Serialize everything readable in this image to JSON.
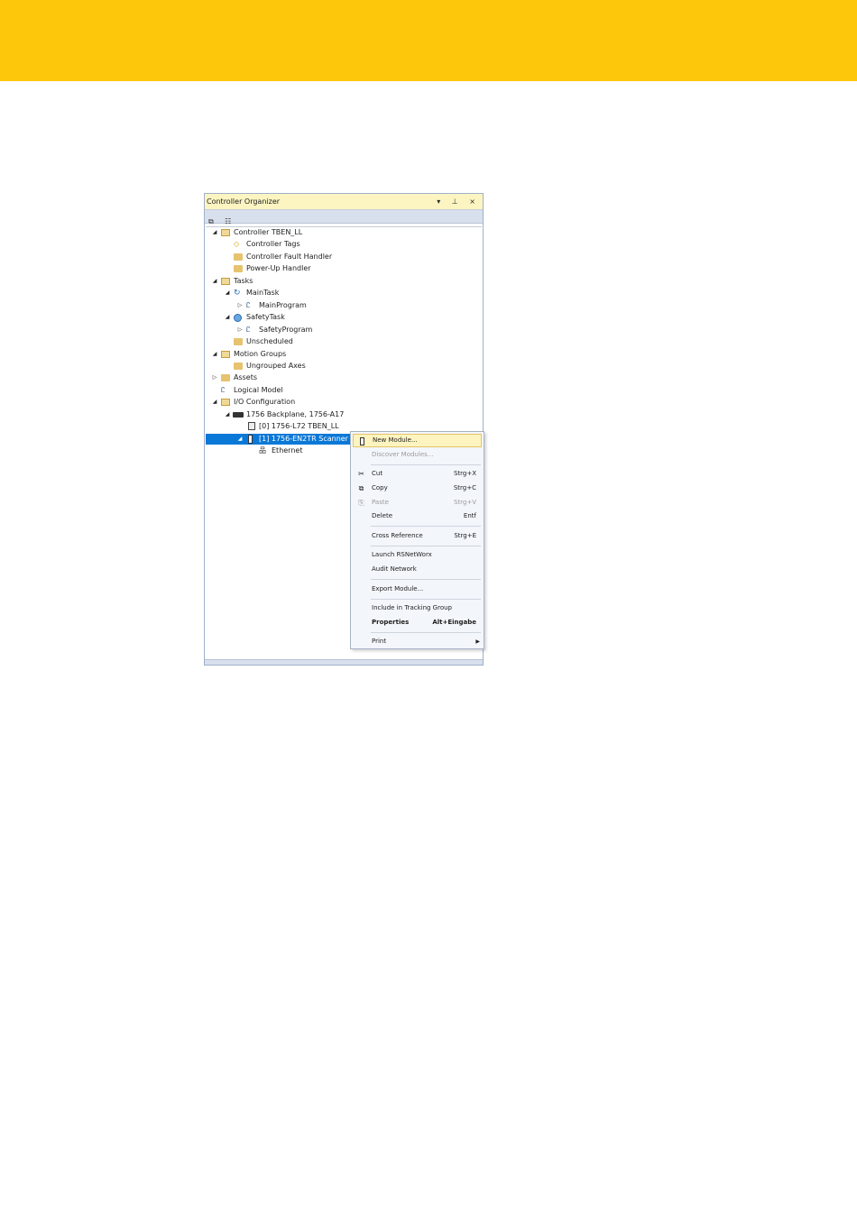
{
  "colors": {
    "accent_band": "#FDC70C",
    "selection": "#0a78d7",
    "menu_highlight": "#fdf4bf"
  },
  "organizer": {
    "title": "Controller Organizer",
    "title_buttons": "▾ ⊥ ×",
    "tree": [
      {
        "label": "Controller TBEN_LL",
        "icon": "folder-open-icon",
        "expander": "expanded"
      },
      {
        "label": "Controller Tags",
        "icon": "tag-icon"
      },
      {
        "label": "Controller Fault Handler",
        "icon": "folder-icon"
      },
      {
        "label": "Power-Up Handler",
        "icon": "folder-icon"
      },
      {
        "label": "Tasks",
        "icon": "folder-open-icon",
        "expander": "expanded"
      },
      {
        "label": "MainTask",
        "icon": "task-cycle-icon",
        "expander": "expanded"
      },
      {
        "label": "MainProgram",
        "icon": "program-icon",
        "expander": "collapsed"
      },
      {
        "label": "SafetyTask",
        "icon": "safety-task-icon",
        "expander": "expanded"
      },
      {
        "label": "SafetyProgram",
        "icon": "program-icon",
        "expander": "collapsed"
      },
      {
        "label": "Unscheduled",
        "icon": "folder-icon"
      },
      {
        "label": "Motion Groups",
        "icon": "folder-open-icon",
        "expander": "expanded"
      },
      {
        "label": "Ungrouped Axes",
        "icon": "folder-icon"
      },
      {
        "label": "Assets",
        "icon": "folder-icon",
        "expander": "collapsed"
      },
      {
        "label": "Logical Model",
        "icon": "logical-model-icon"
      },
      {
        "label": "I/O Configuration",
        "icon": "folder-open-icon",
        "expander": "expanded"
      },
      {
        "label": "1756 Backplane, 1756-A17",
        "icon": "backplane-icon",
        "expander": "expanded"
      },
      {
        "label": "[0] 1756-L72 TBEN_LL",
        "icon": "controller-module-icon"
      },
      {
        "label": "[1] 1756-EN2TR Scanner",
        "icon": "ethernet-module-icon",
        "expander": "expanded",
        "selected": true
      },
      {
        "label": "Ethernet",
        "icon": "network-icon"
      }
    ]
  },
  "context_menu": {
    "items": [
      {
        "label": "New Module...",
        "shortcut": "",
        "icon": "module-icon",
        "state": "highlighted"
      },
      {
        "label": "Discover Modules...",
        "shortcut": "",
        "state": "disabled"
      },
      {
        "label": "Cut",
        "shortcut": "Strg+X",
        "icon": "cut-icon"
      },
      {
        "label": "Copy",
        "shortcut": "Strg+C",
        "icon": "copy-icon"
      },
      {
        "label": "Paste",
        "shortcut": "Strg+V",
        "icon": "paste-icon",
        "state": "disabled"
      },
      {
        "label": "Delete",
        "shortcut": "Entf"
      },
      {
        "label": "Cross Reference",
        "shortcut": "Strg+E"
      },
      {
        "label": "Launch RSNetWorx",
        "shortcut": ""
      },
      {
        "label": "Audit Network",
        "shortcut": ""
      },
      {
        "label": "Export Module...",
        "shortcut": ""
      },
      {
        "label": "Include in Tracking Group",
        "shortcut": ""
      },
      {
        "label": "Properties",
        "shortcut": "Alt+Eingabe",
        "state": "bold"
      },
      {
        "label": "Print",
        "shortcut": "",
        "submenu": true
      }
    ]
  }
}
